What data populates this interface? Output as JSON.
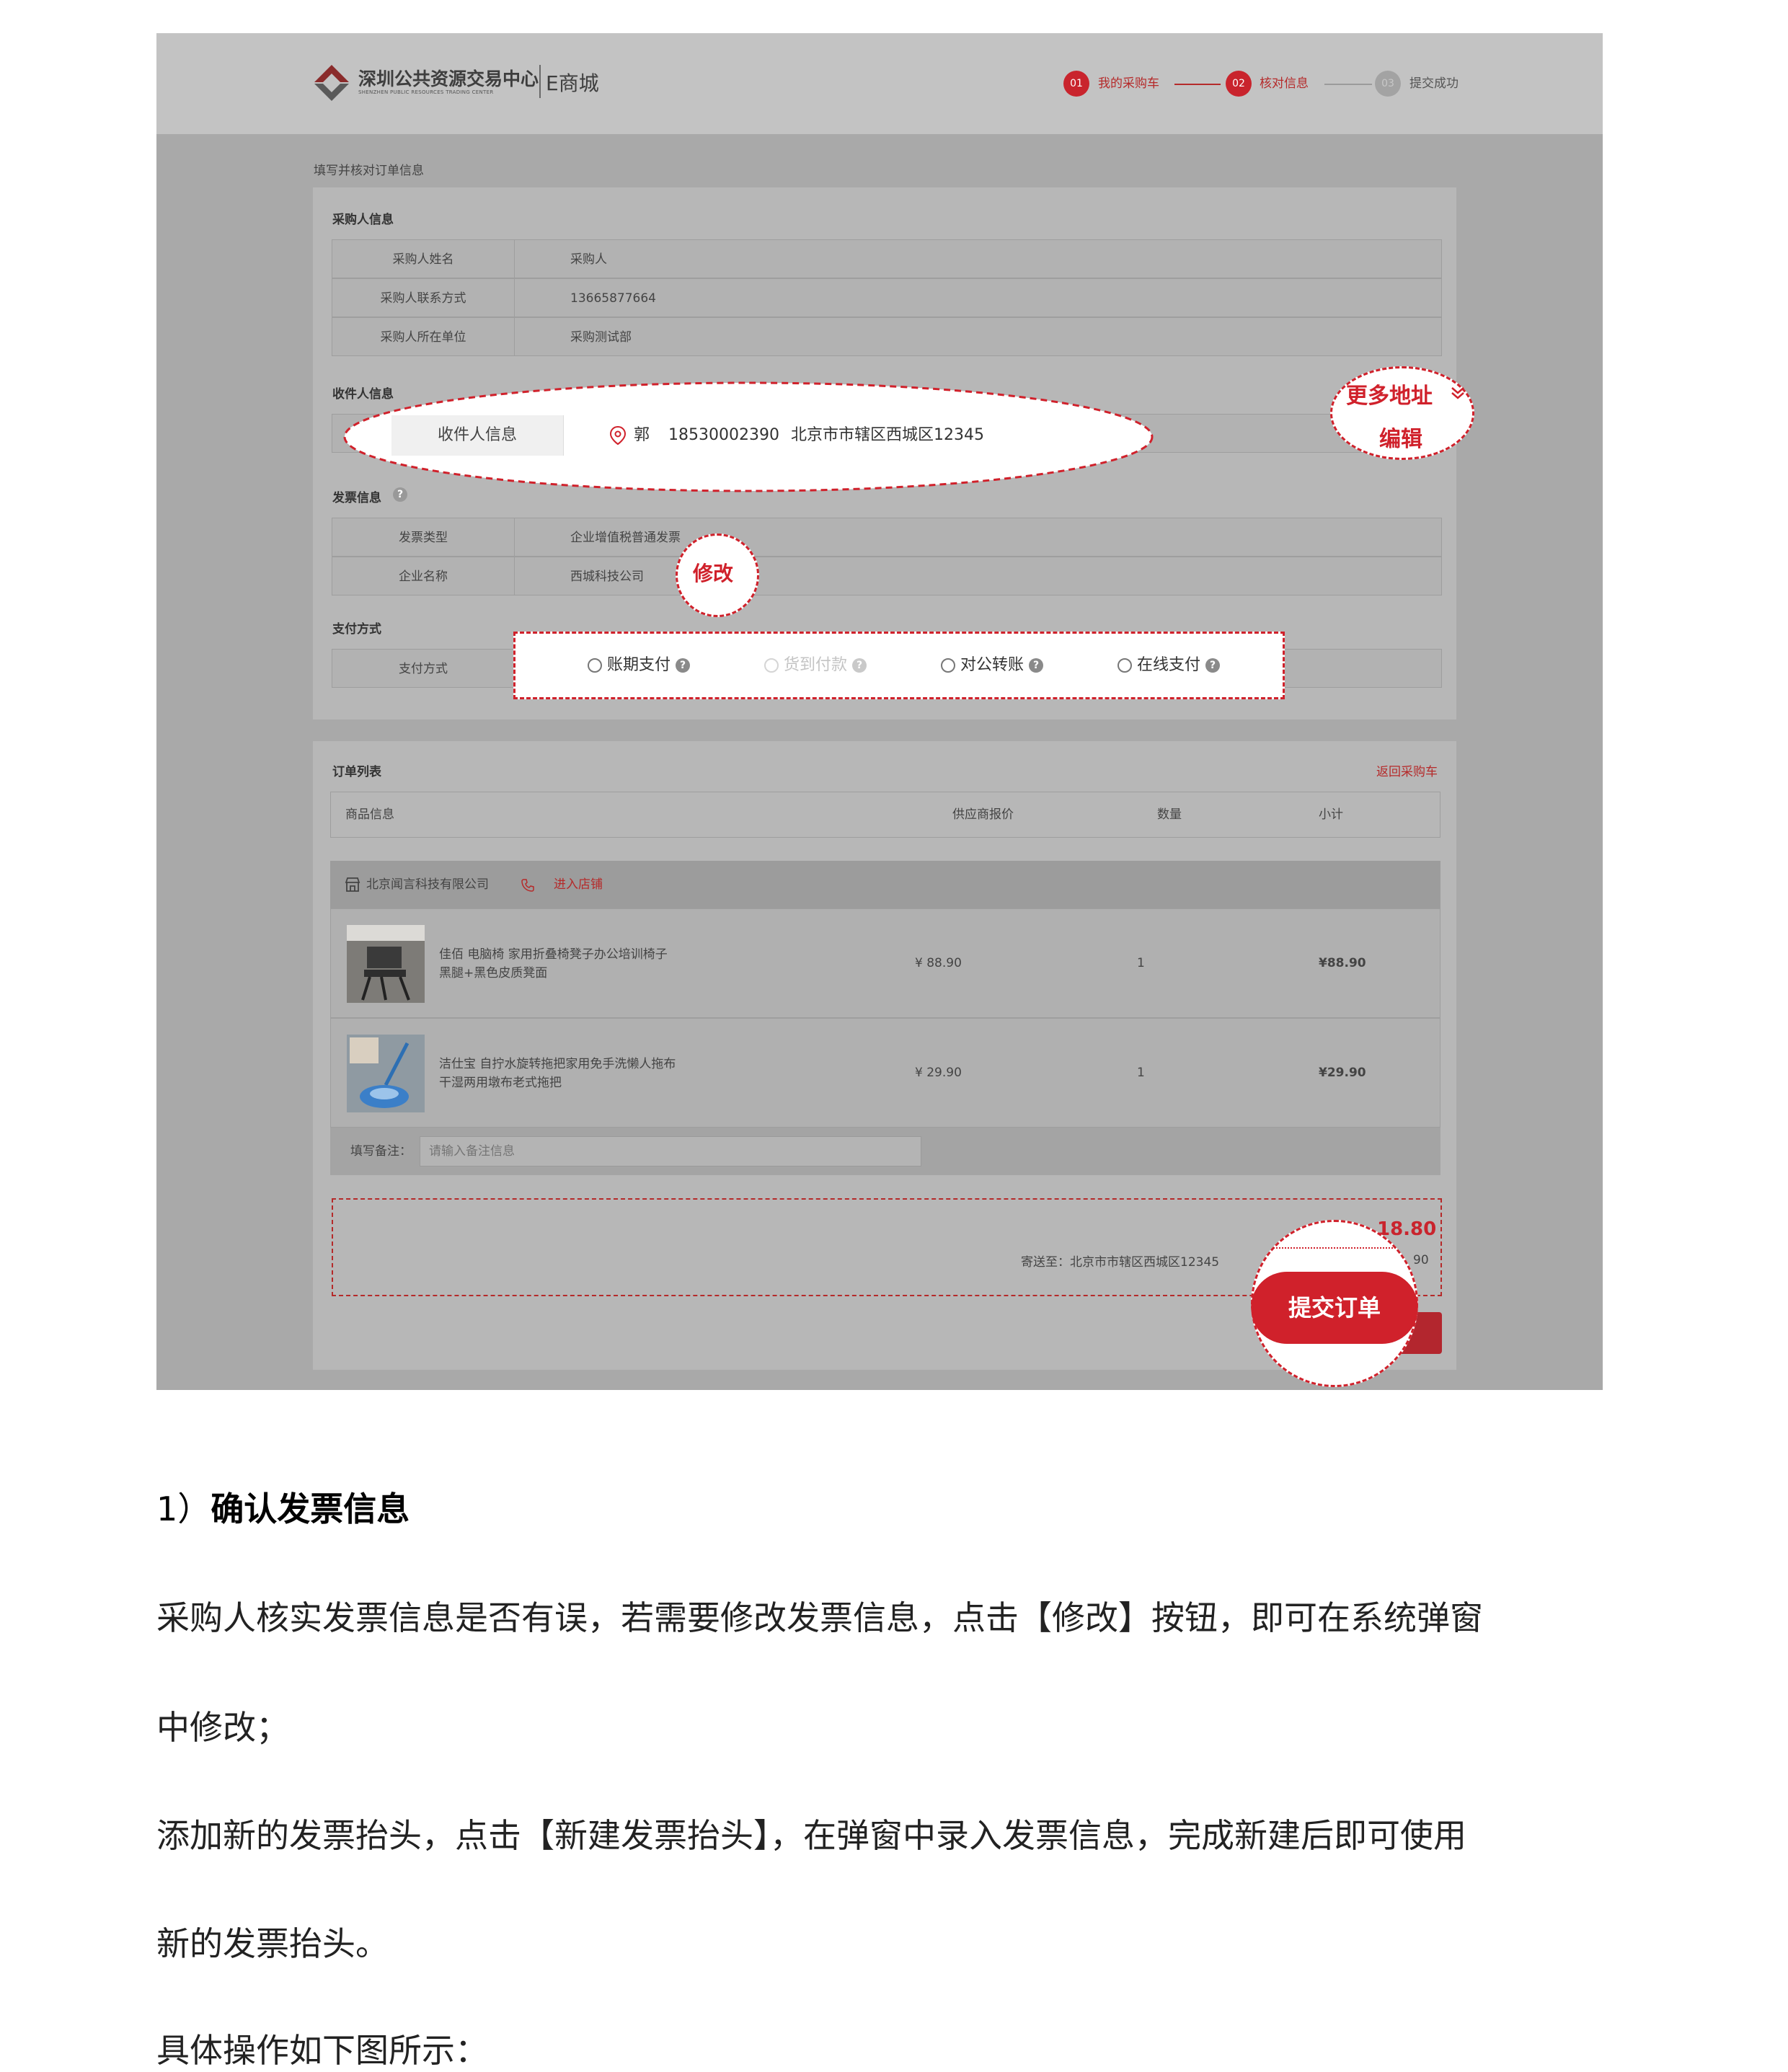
{
  "screenshot": {
    "logo": {
      "name_cn": "深圳公共资源交易中心",
      "name_en": "SHENZHEN PUBLIC RESOURCES TRADING CENTER",
      "emall": "E商城"
    },
    "steps": [
      {
        "num": "01",
        "label": "我的采购车",
        "state": "done"
      },
      {
        "num": "02",
        "label": "核对信息",
        "state": "active"
      },
      {
        "num": "03",
        "label": "提交成功",
        "state": "pending"
      }
    ],
    "page_title": "填写并核对订单信息",
    "buyer": {
      "title": "采购人信息",
      "rows": [
        {
          "label": "采购人姓名",
          "value": "采购人"
        },
        {
          "label": "采购人联系方式",
          "value": "13665877664"
        },
        {
          "label": "采购人所在单位",
          "value": "采购测试部"
        }
      ]
    },
    "recipient": {
      "title": "收件人信息",
      "label": "收件人信息",
      "name": "郭",
      "phone": "18530002390",
      "address": "北京市市辖区西城区12345",
      "more_address": "更多地址",
      "edit": "编辑"
    },
    "invoice": {
      "title": "发票信息",
      "rows": [
        {
          "label": "发票类型",
          "value": "企业增值税普通发票"
        },
        {
          "label": "企业名称",
          "value": "西城科技公司"
        }
      ],
      "modify": "修改"
    },
    "payment": {
      "title": "支付方式",
      "label": "支付方式",
      "options": [
        "账期支付",
        "货到付款",
        "对公转账",
        "在线支付"
      ]
    },
    "orders": {
      "title": "订单列表",
      "back_link": "返回采购车",
      "headers": [
        "商品信息",
        "供应商报价",
        "数量",
        "小计"
      ],
      "shop": {
        "name": "北京闻言科技有限公司",
        "enter_link": "进入店铺"
      },
      "items": [
        {
          "name": "佳佰 电脑椅 家用折叠椅凳子办公培训椅子 黑腿+黑色皮质凳面",
          "price": "¥ 88.90",
          "qty": "1",
          "subtotal": "¥88.90"
        },
        {
          "name": "洁仕宝 自拧水旋转拖把家用免手洗懒人拖布干湿两用墩布老式拖把",
          "price": "¥ 29.90",
          "qty": "1",
          "subtotal": "¥29.90"
        }
      ],
      "remark_label": "填写备注：",
      "remark_placeholder": "请输入备注信息",
      "ship_to": "寄送至：北京市市辖区西城区12345",
      "total_partial": "18.80",
      "sub_partial": "90",
      "submit": "提交订单"
    }
  },
  "document": {
    "heading_num": "1）",
    "heading": "确认发票信息",
    "paragraphs": [
      "采购人核实发票信息是否有误，若需要修改发票信息，点击【修改】按钮，即可在系统弹窗",
      "中修改；",
      "添加新的发票抬头，点击【新建发票抬头】，在弹窗中录入发票信息，完成新建后即可使用",
      "新的发票抬头。",
      "具体操作如下图所示："
    ]
  },
  "colors": {
    "accent_red": "#d0212b",
    "mask_gray": "#a9a9a9"
  },
  "icons": [
    "logo-mark-icon",
    "location-pin-icon",
    "chevron-down-icon",
    "question-icon",
    "store-icon",
    "phone-icon"
  ]
}
